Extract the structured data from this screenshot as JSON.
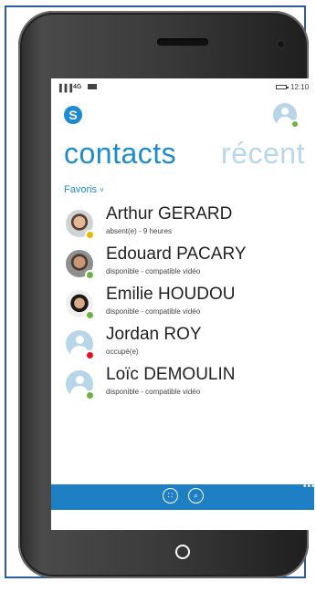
{
  "status_bar": {
    "signal": "▐▐▐",
    "network": "4G",
    "time": "12:10"
  },
  "header": {
    "logo_letter": "S",
    "pivots": [
      {
        "label": "contacts",
        "active": true
      },
      {
        "label": "récent",
        "active": false
      }
    ],
    "filter_label": "Favoris",
    "filter_chevron": "˅"
  },
  "contacts": [
    {
      "name": "Arthur GERARD",
      "status": "absent(e) - 9 heures",
      "presence": "away",
      "presence_color": "#f0b400",
      "avatar": "photo"
    },
    {
      "name": "Edouard PACARY",
      "status": "disponible - compatible vidéo",
      "presence": "available",
      "presence_color": "#6cb33f",
      "avatar": "photo"
    },
    {
      "name": "Emilie HOUDOU",
      "status": "disponible - compatible vidéo",
      "presence": "available",
      "presence_color": "#6cb33f",
      "avatar": "photo"
    },
    {
      "name": "Jordan ROY",
      "status": "occupé(e)",
      "presence": "busy",
      "presence_color": "#e81123",
      "avatar": "placeholder"
    },
    {
      "name": "Loïc DEMOULIN",
      "status": "disponible - compatible vidéo",
      "presence": "available",
      "presence_color": "#6cb33f",
      "avatar": "placeholder"
    }
  ],
  "app_bar": {
    "buttons": [
      {
        "icon": "dialpad-icon",
        "glyph": "∷"
      },
      {
        "icon": "search-icon",
        "glyph": "⌕"
      }
    ],
    "more": "•••"
  },
  "colors": {
    "accent": "#1e8bd1",
    "inactive_pivot": "#b8d7ef",
    "app_bar": "#1f7fc4"
  }
}
